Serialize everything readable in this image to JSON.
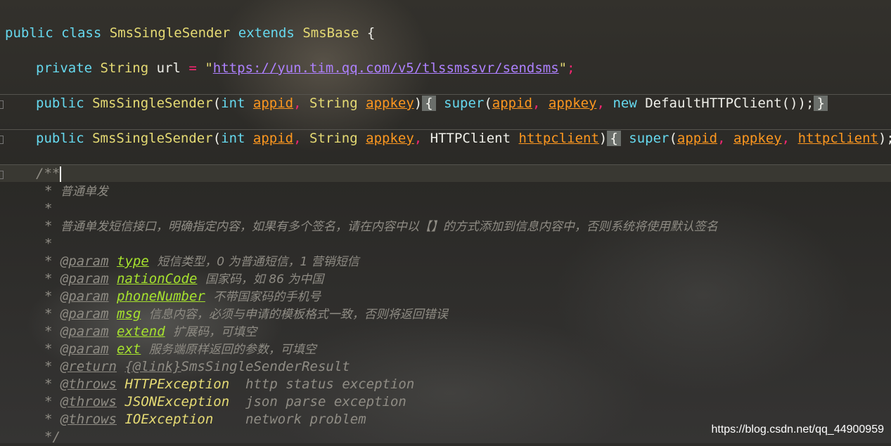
{
  "code": {
    "l1": {
      "kw1": "public",
      "kw2": "class",
      "cls": "SmsSingleSender",
      "kw3": "extends",
      "base": "SmsBase",
      "brace": " {"
    },
    "l2": {
      "kw": "private",
      "type": "String",
      "name": "url",
      "eq": "=",
      "q1": "\"",
      "url": "https://yun.tim.qq.com/v5/tlssmssvr/sendsms",
      "q2": "\"",
      "semi": ";"
    },
    "l3": {
      "kw": "public",
      "cls": "SmsSingleSender",
      "open": "(",
      "t1": "int",
      "p1": "appid",
      "c1": ",",
      "t2": "String",
      "p2": "appkey",
      "close": ")",
      "fold_open": "{",
      "sup": "super",
      "sopen": "(",
      "a1": "appid",
      "c2": ",",
      "a2": "appkey",
      "c3": ",",
      "new": "new",
      "ctor": "DefaultHTTPClient());",
      "fold_close": "}"
    },
    "l4": {
      "kw": "public",
      "cls": "SmsSingleSender",
      "open": "(",
      "t1": "int",
      "p1": "appid",
      "c1": ",",
      "t2": "String",
      "p2": "appkey",
      "c2": ",",
      "t3": "HTTPClient",
      "p3": "httpclient",
      "close": ")",
      "fold_open": "{",
      "sup": "super",
      "sopen": "(",
      "a1": "appid",
      "c3": ",",
      "a2": "appkey",
      "c4": ",",
      "a3": "httpclient",
      "end": ");",
      "fold_close": "}"
    }
  },
  "doc": {
    "open": "/**",
    "title": "普通单发",
    "desc": "普通单发短信接口，明确指定内容，如果有多个签名，请在内容中以【】的方式添加到信息内容中，否则系统将使用默认签名",
    "star": "*",
    "params": [
      {
        "tag": "@param",
        "name": "type",
        "desc": "短信类型，0 为普通短信，1 营销短信"
      },
      {
        "tag": "@param",
        "name": "nationCode",
        "desc": "国家码，如 86 为中国"
      },
      {
        "tag": "@param",
        "name": "phoneNumber",
        "desc": "不带国家码的手机号"
      },
      {
        "tag": "@param",
        "name": "msg",
        "desc": "信息内容，必须与申请的模板格式一致，否则将返回错误"
      },
      {
        "tag": "@param",
        "name": "extend",
        "desc": "扩展码，可填空"
      },
      {
        "tag": "@param",
        "name": "ext",
        "desc": "服务端原样返回的参数，可填空"
      }
    ],
    "return": {
      "tag": "@return",
      "link": "{@link}",
      "value": "SmsSingleSenderResult"
    },
    "throws": [
      {
        "tag": "@throws",
        "name": "HTTPException",
        "desc": "http status exception"
      },
      {
        "tag": "@throws",
        "name": "JSONException",
        "desc": "json parse exception"
      },
      {
        "tag": "@throws",
        "name": "IOException",
        "desc": "network problem"
      }
    ],
    "close": "*/"
  },
  "watermark": "https://blog.csdn.net/qq_44900959"
}
